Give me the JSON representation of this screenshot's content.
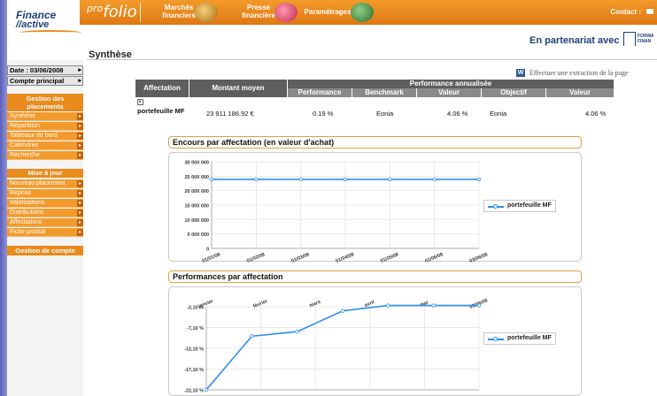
{
  "brand": {
    "logo_line1": "Finance",
    "logo_line2": "//active",
    "product_pre": "pro",
    "product": "folio"
  },
  "top_menu": [
    {
      "label": "Marchés\nfinanciers",
      "icon": "market-icon"
    },
    {
      "label": "Presse\nfinancière",
      "icon": "press-icon"
    },
    {
      "label": "Paramétrages",
      "icon": "settings-person-icon"
    }
  ],
  "contact_label": "Contact :",
  "partner": {
    "label": "En partenariat avec",
    "logo_line1": "FORWA",
    "logo_line2": "FINAN"
  },
  "page_title": "Synthèse",
  "sidebar": {
    "date_label": "Date : 03/06/2008",
    "account_label": "Compte principal",
    "section1_title": "Gestion des placements",
    "section1_items": [
      "Synthèse",
      "Répartition",
      "Tableaux de bord",
      "Calendrier",
      "Recherche"
    ],
    "section2_title": "Mise à jour",
    "section2_items": [
      "Nouveau placement",
      "Reprise",
      "Valorisations",
      "Distributions",
      "Affectations",
      "Fiche produit"
    ],
    "section3_title": "Gestion de compte"
  },
  "extract_icon": "W",
  "extract_label": "Effectuer une extraction de la page",
  "table": {
    "group_header": "Performance annualisée",
    "headers": [
      "Affectation",
      "Montant moyen",
      "Performance",
      "Benchmark",
      "Valeur",
      "Objectif",
      "Valeur"
    ],
    "rows": [
      {
        "expand": "▸",
        "affectation": "portefeuille MF",
        "montant": "23 911 186.92 €",
        "performance": "0.19 %",
        "benchmark": "Eonia",
        "valeur": "4.06 %",
        "objectif": "Eonia",
        "valeur2": "4.06 %"
      }
    ]
  },
  "chart1_title": "Encours par affectation (en valeur d'achat)",
  "chart2_title": "Performances par affectation",
  "colors": {
    "accent": "#e88a1c",
    "series": "#2c8ef0"
  },
  "chart_data": [
    {
      "type": "line",
      "title": "Encours par affectation (en valeur d'achat)",
      "x": [
        "01/01/08",
        "01/02/08",
        "01/03/08",
        "01/04/08",
        "01/05/08",
        "01/06/08",
        "03/06/08"
      ],
      "y_ticks": [
        "30 000 000",
        "25 000 000",
        "20 000 000",
        "15 000 000",
        "10 000 000",
        "5 000 000",
        "0"
      ],
      "ylim": [
        0,
        30000000
      ],
      "series": [
        {
          "name": "portefeuille MF",
          "values": [
            23911187,
            23911187,
            23911187,
            23911187,
            23911187,
            23911187,
            23911187
          ]
        }
      ],
      "legend": "right",
      "grid": true
    },
    {
      "type": "line",
      "title": "Performances par affectation",
      "x": [
        "janvier",
        "février",
        "mars",
        "avril",
        "mai",
        "03/06/08"
      ],
      "y_ticks": [
        "-2,10 %",
        "-7,10 %",
        "-12,10 %",
        "-17,10 %",
        "-22,10 %"
      ],
      "ylim": [
        -22.1,
        -2.1
      ],
      "series": [
        {
          "name": "portefeuille MF",
          "values": [
            -22.1,
            -9.2,
            -8.1,
            -3.1,
            -1.8,
            -1.8,
            -1.8
          ]
        }
      ],
      "legend": "right",
      "grid": true
    }
  ]
}
